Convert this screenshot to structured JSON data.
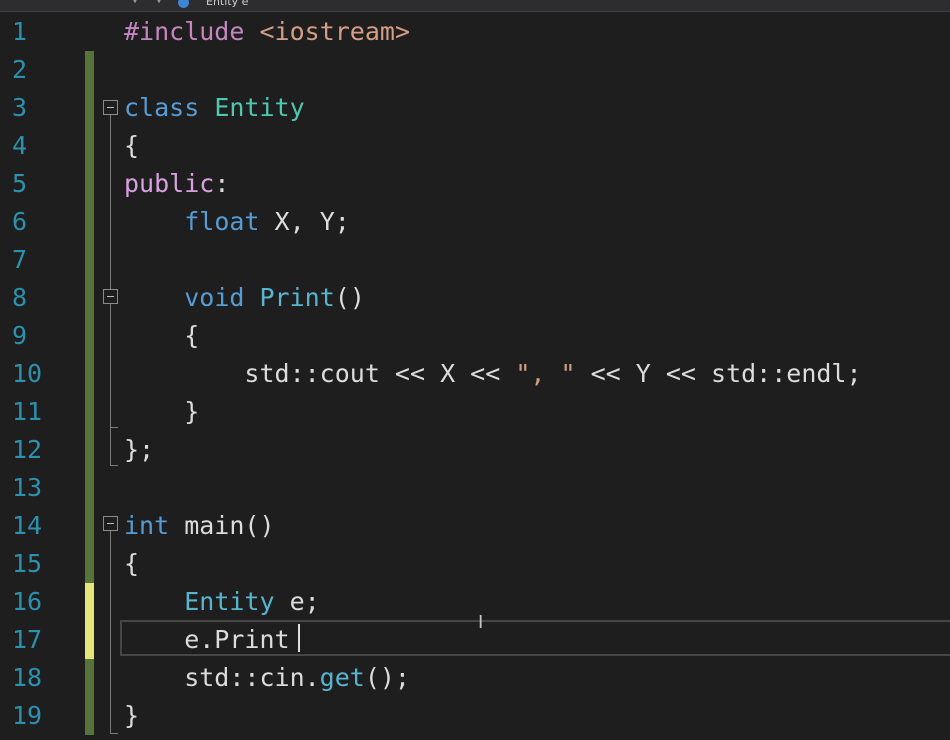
{
  "toolbar": {
    "nav_arrows": "▾ ▾",
    "scope_label": "Entity e",
    "scope_icon": "class-member-icon"
  },
  "editor": {
    "line_numbers": [
      "1",
      "2",
      "3",
      "4",
      "5",
      "6",
      "7",
      "8",
      "9",
      "10",
      "11",
      "12",
      "13",
      "14",
      "15",
      "16",
      "17",
      "18",
      "19"
    ],
    "lines": {
      "l1": [
        "#include",
        " ",
        "<iostream>"
      ],
      "l3": [
        "class",
        " ",
        "Entity"
      ],
      "l4": [
        "{"
      ],
      "l5": [
        "public",
        ":"
      ],
      "l6": [
        "    ",
        "float",
        " X, Y;"
      ],
      "l8": [
        "    ",
        "void",
        " ",
        "Print",
        "()"
      ],
      "l9": [
        "    {"
      ],
      "l10": [
        "        std::cout << X << ",
        "\", \"",
        " << Y << std::endl;"
      ],
      "l11": [
        "    }"
      ],
      "l12": [
        "};"
      ],
      "l14": [
        "int",
        " main()"
      ],
      "l15": [
        "{"
      ],
      "l16": [
        "    ",
        "Entity",
        " e;"
      ],
      "l17": [
        "    e.Print"
      ],
      "l18": [
        "    std::cin.",
        "get",
        "();"
      ],
      "l19": [
        "}"
      ]
    },
    "colors": {
      "background": "#1e1e1e",
      "line_number": "#2b91af",
      "keyword": "#569cd6",
      "access_keyword": "#d8a0df",
      "type": "#4ec9b0",
      "string": "#d69d85",
      "saved_change": "#57733a",
      "unsaved_change": "#e5e57a"
    }
  }
}
